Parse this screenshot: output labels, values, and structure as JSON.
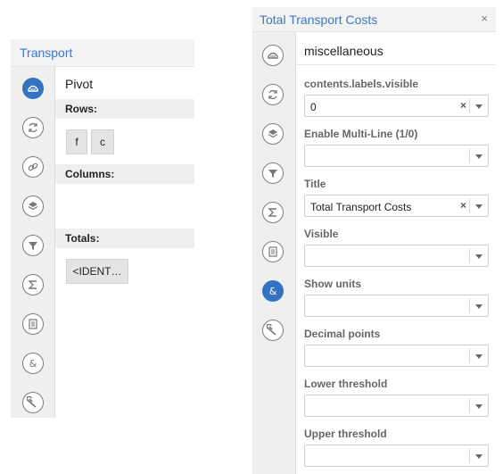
{
  "left_panel": {
    "title": "Transport",
    "header": "Pivot",
    "rows_label": "Rows:",
    "rows_chips": [
      "f",
      "c"
    ],
    "columns_label": "Columns:",
    "totals_label": "Totals:",
    "totals_chip": "<IDENT…",
    "sidebar_icons": [
      "chart-icon",
      "refresh-icon",
      "link-icon",
      "layers-icon",
      "filter-icon",
      "sigma-icon",
      "list-icon",
      "ampersand-icon",
      "wrench-icon"
    ]
  },
  "right_panel": {
    "title": "Total Transport Costs",
    "close_label": "×",
    "header": "miscellaneous",
    "sidebar_icons": [
      "chart-icon",
      "refresh-icon",
      "layers-icon",
      "filter-icon",
      "sigma-icon",
      "list-icon",
      "ampersand-icon",
      "wrench-icon"
    ],
    "fields": [
      {
        "label": "contents.labels.visible",
        "value": "0",
        "clearable": true
      },
      {
        "label": "Enable Multi-Line (1/0)",
        "value": "",
        "clearable": false
      },
      {
        "label": "Title",
        "value": "Total Transport Costs",
        "clearable": true
      },
      {
        "label": "Visible",
        "value": "",
        "clearable": false
      },
      {
        "label": "Show units",
        "value": "",
        "clearable": false
      },
      {
        "label": "Decimal points",
        "value": "",
        "clearable": false
      },
      {
        "label": "Lower threshold",
        "value": "",
        "clearable": false
      },
      {
        "label": "Upper threshold",
        "value": "",
        "clearable": false
      }
    ],
    "clear_glyph": "×"
  },
  "colors": {
    "accent": "#3c78c3",
    "active_icon": "#3572c2",
    "sidebar_bg": "#efefef",
    "section_bg": "#efefef"
  }
}
